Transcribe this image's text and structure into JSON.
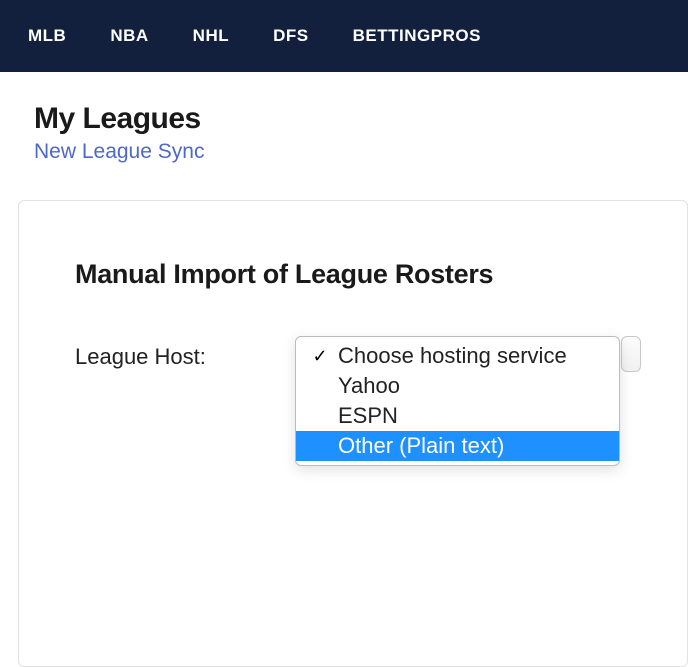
{
  "nav": {
    "items": [
      "MLB",
      "NBA",
      "NHL",
      "DFS",
      "BETTINGPROS"
    ]
  },
  "header": {
    "title": "My Leagues",
    "subtitle": "New League Sync"
  },
  "card": {
    "title": "Manual Import of League Rosters"
  },
  "field": {
    "label": "League Host:"
  },
  "dropdown": {
    "options": [
      {
        "label": "Choose hosting service",
        "selected": true,
        "highlighted": false
      },
      {
        "label": "Yahoo",
        "selected": false,
        "highlighted": false
      },
      {
        "label": "ESPN",
        "selected": false,
        "highlighted": false
      },
      {
        "label": "Other (Plain text)",
        "selected": false,
        "highlighted": true
      }
    ]
  }
}
